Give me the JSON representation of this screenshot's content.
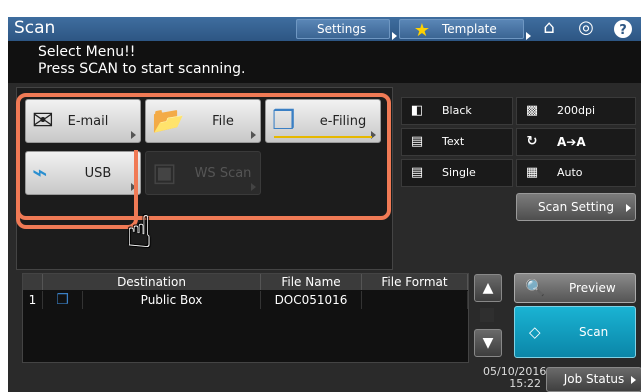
{
  "title_bar": {
    "app_title": "Scan",
    "settings_label": "Settings",
    "template_label": "Template",
    "icons": [
      "star-icon",
      "home-icon",
      "globe-icon",
      "help-icon"
    ]
  },
  "message": {
    "line1": "Select Menu!!",
    "line2": "Press SCAN to start scanning."
  },
  "menu": {
    "email": "E-mail",
    "file": "File",
    "efiling": "e-Filing",
    "usb": "USB",
    "ws_scan": "WS Scan"
  },
  "settings": {
    "color": "Black",
    "resolution": "200dpi",
    "original_mode": "Text",
    "rotation": "A➔A",
    "duplex": "Single",
    "size": "Auto",
    "scan_setting_label": "Scan Setting"
  },
  "table": {
    "headers": [
      "Destination",
      "File Name",
      "File Format"
    ],
    "rows": [
      {
        "index": "1",
        "destination": "Public Box",
        "file_name": "DOC051016",
        "file_format": ""
      }
    ]
  },
  "actions": {
    "preview_label": "Preview",
    "scan_label": "Scan"
  },
  "status": {
    "date": "05/10/2016",
    "time": "15:22",
    "job_status_label": "Job Status"
  },
  "colors": {
    "title_bar": "#2d5683",
    "highlight": "#f07a55",
    "scan_button": "#0b86a8",
    "active_underline": "#e6b800"
  }
}
